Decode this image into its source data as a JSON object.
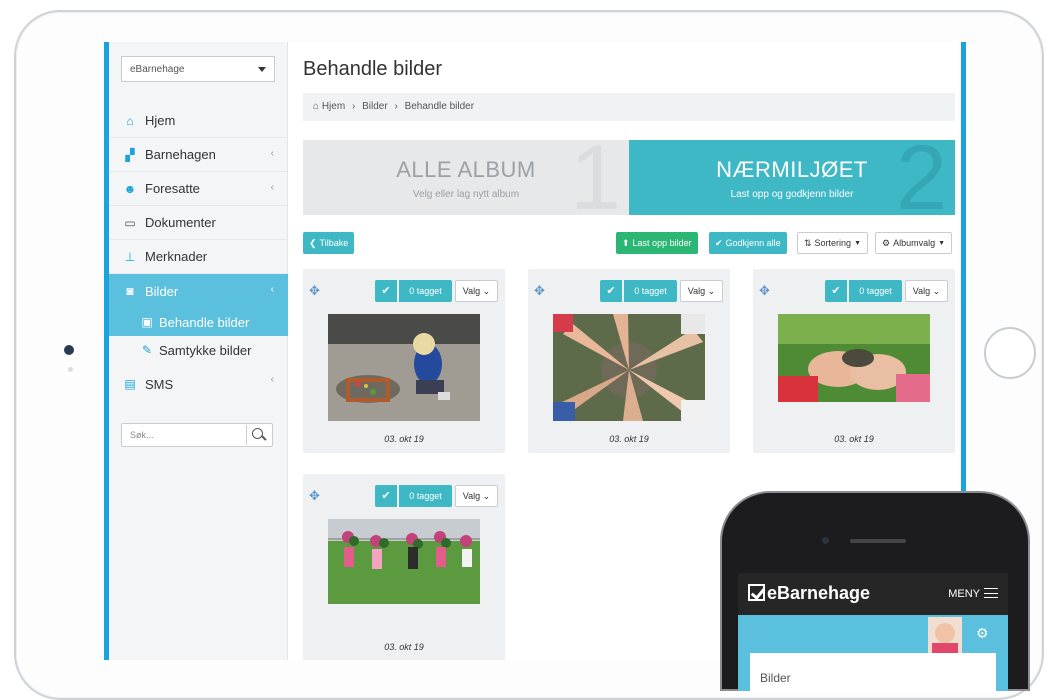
{
  "app": {
    "name": "eBarnehage"
  },
  "sidebar": {
    "selector": "eBarnehage",
    "items": [
      {
        "label": "Hjem",
        "icon": "home-icon",
        "chevron": ""
      },
      {
        "label": "Barnehagen",
        "icon": "sitemap-icon",
        "chevron": "‹"
      },
      {
        "label": "Foresatte",
        "icon": "users-icon",
        "chevron": "‹"
      },
      {
        "label": "Dokumenter",
        "icon": "folder-icon",
        "chevron": ""
      },
      {
        "label": "Merknader",
        "icon": "pin-icon",
        "chevron": ""
      },
      {
        "label": "Bilder",
        "icon": "camera-icon",
        "chevron": "‹"
      }
    ],
    "subitems": [
      {
        "label": "Behandle bilder",
        "icon": "image-icon"
      },
      {
        "label": "Samtykke bilder",
        "icon": "edit-icon"
      }
    ],
    "sms": {
      "label": "SMS",
      "icon": "sms-icon",
      "chevron": "‹"
    },
    "search_placeholder": "Søk..."
  },
  "main": {
    "title": "Behandle bilder",
    "breadcrumb": [
      "Hjem",
      "Bilder",
      "Behandle bilder"
    ],
    "breadcrumb_sep": "›",
    "steps": [
      {
        "title": "ALLE ALBUM",
        "subtitle": "Velg eller lag nytt album",
        "number": "1"
      },
      {
        "title": "NÆRMILJØET",
        "subtitle": "Last opp og godkjenn bilder",
        "number": "2"
      }
    ],
    "toolbar": {
      "back": "Tilbake",
      "upload": "Last opp bilder",
      "approve": "Godkjenn alle",
      "sort": "Sortering",
      "album": "Albumvalg"
    },
    "cards": [
      {
        "tag": "0 tagget",
        "valg": "Valg",
        "date": "03. okt 19"
      },
      {
        "tag": "0 tagget",
        "valg": "Valg",
        "date": "03. okt 19"
      },
      {
        "tag": "0 tagget",
        "valg": "Valg",
        "date": "03. okt 19"
      },
      {
        "tag": "0 tagget",
        "valg": "Valg",
        "date": "03. okt 19"
      }
    ]
  },
  "phone": {
    "brand": "eBarnehage",
    "menu": "MENY",
    "card_label": "Bilder"
  },
  "colors": {
    "accent": "#3fb8c6",
    "sidebar_active": "#5bc0de",
    "border_blue": "#1aa3dc",
    "green": "#2bb673"
  }
}
